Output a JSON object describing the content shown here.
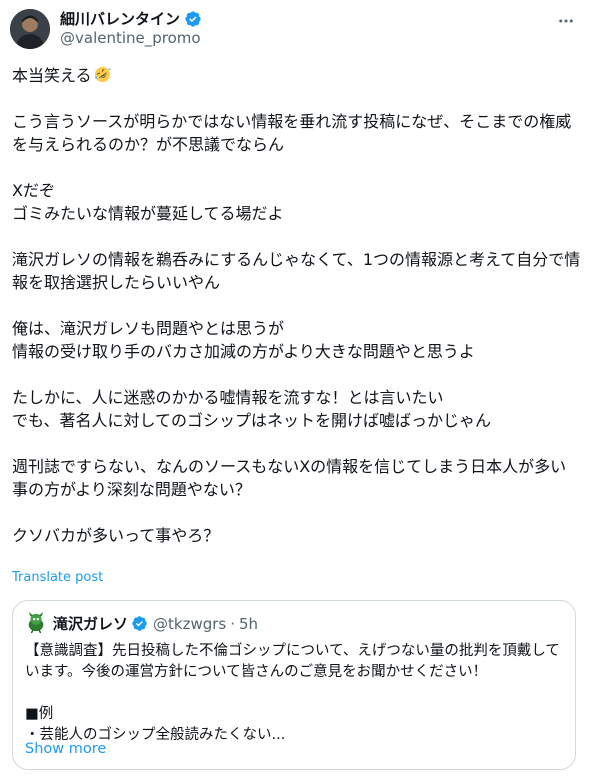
{
  "author": {
    "display_name": "細川バレンタイン",
    "handle": "@valentine_promo",
    "verified": true
  },
  "icons": {
    "verified": "verified-badge-icon",
    "more": "more-options-icon",
    "emoji": "rolling-on-floor-laughing-emoji",
    "quote_avatar": "green-mascot-avatar"
  },
  "colors": {
    "link": "#1d9bf0",
    "secondary_text": "#536471",
    "border": "#cfd9de",
    "verified": "#1d9bf0"
  },
  "tweet": {
    "paragraphs": [
      "本当笑える",
      "こう言うソースが明らかではない情報を垂れ流す投稿になぜ、そこまでの権威を与えられるのか？が不思議でならん",
      "Xだぞ\nゴミみたいな情報が蔓延してる場だよ",
      "滝沢ガレソの情報を鵜呑みにするんじゃなくて、1つの情報源と考えて自分で情報を取捨選択したらいいやん",
      "俺は、滝沢ガレソも問題やとは思うが\n情報の受け取り手のバカさ加減の方がより大きな問題やと思うよ",
      "たしかに、人に迷惑のかかる嘘情報を流すな！とは言いたい\nでも、著名人に対してのゴシップはネットを開けば嘘ばっかじゃん",
      "週刊誌ですらない、なんのソースもないXの情報を信じてしまう日本人が多い事の方がより深刻な問題やない？",
      "クソバカが多いって事やろ？"
    ],
    "translate_label": "Translate post"
  },
  "quote": {
    "display_name": "滝沢ガレソ",
    "verified": true,
    "handle": "@tkzwgrs",
    "separator": "·",
    "time": "5h",
    "text": "【意識調査】先日投稿した不倫ゴシップについて、えげつない量の批判を頂戴しています。今後の運営方針について皆さんのご意見をお聞かせください！\n\n■例\n・芸能人のゴシップ全般読みたくない...",
    "show_more_label": "Show more"
  }
}
